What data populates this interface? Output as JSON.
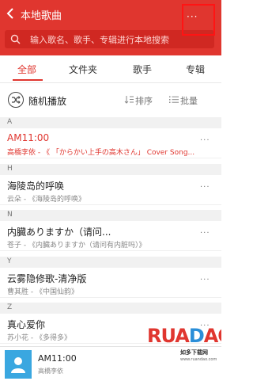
{
  "header": {
    "title": "本地歌曲",
    "more_label": "···",
    "search_placeholder": "输入歌名、歌手、专辑进行本地搜索"
  },
  "tabs": [
    {
      "label": "全部",
      "active": true
    },
    {
      "label": "文件夹",
      "active": false
    },
    {
      "label": "歌手",
      "active": false
    },
    {
      "label": "专辑",
      "active": false
    }
  ],
  "actions": {
    "shuffle_label": "随机播放",
    "sort_label": "排序",
    "batch_label": "批量"
  },
  "sections": [
    {
      "letter": "A",
      "songs": [
        {
          "title": "AM11:00",
          "subtitle": "高橋李依 - 《 「からかい上手の高木さん」 Cover Song...",
          "playing": true
        }
      ]
    },
    {
      "letter": "H",
      "songs": [
        {
          "title": "海陵岛的呼唤",
          "subtitle": "云朵 - 《海陵岛的呼唤》",
          "playing": false
        }
      ]
    },
    {
      "letter": "N",
      "songs": [
        {
          "title": "内臓ありますか（请问...",
          "subtitle": "苍子 - 《内臓ありますか（请问有内脏吗）》",
          "playing": false
        }
      ]
    },
    {
      "letter": "Y",
      "songs": [
        {
          "title": "云雾隐修歌-清净版",
          "subtitle": "曹其胜 - 《中国仙韵》",
          "playing": false
        }
      ]
    },
    {
      "letter": "Z",
      "songs": [
        {
          "title": "真心爱你",
          "subtitle": "苏小花 - 《多得多》",
          "playing": false
        }
      ]
    }
  ],
  "player": {
    "title": "AM11:00",
    "artist": "高橋李依"
  },
  "watermark": {
    "brand": "RUANDAO",
    "sub": "如多下载网",
    "url": "www.ruandao.com"
  },
  "colors": {
    "accent": "#e0362f",
    "highlight_box": "#ff1414"
  },
  "icons": {
    "back": "chevron-left-icon",
    "search": "search-icon",
    "shuffle": "shuffle-icon",
    "sort": "sort-icon",
    "batch": "list-icon",
    "more": "more-dots-icon",
    "album": "person-icon"
  }
}
